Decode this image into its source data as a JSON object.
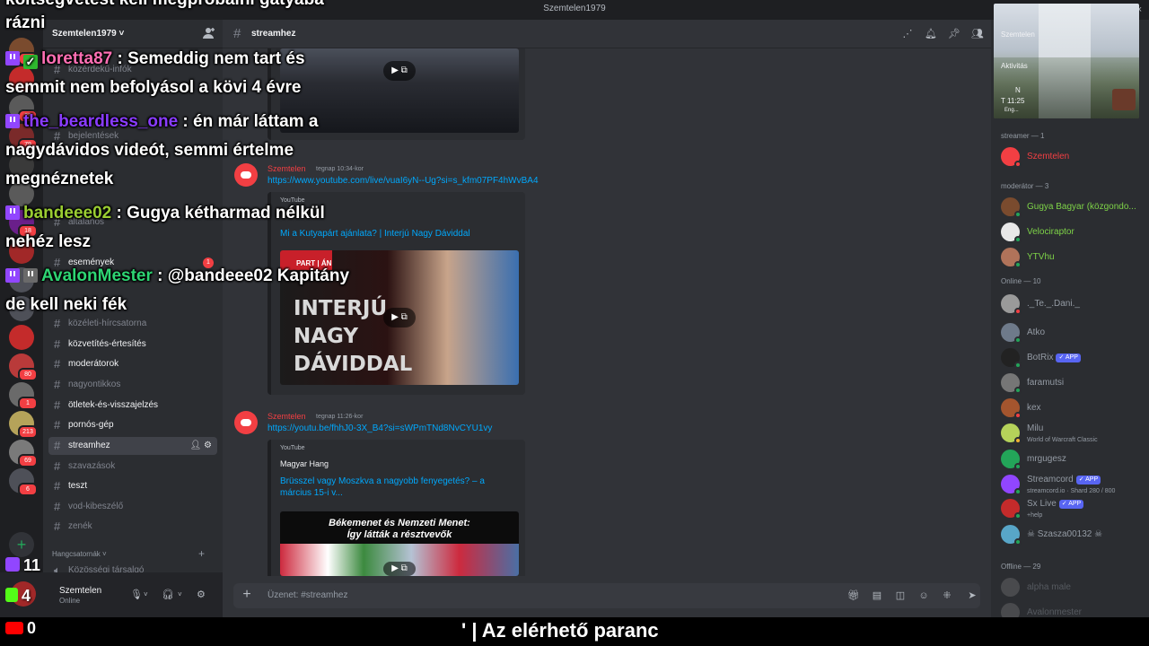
{
  "window": {
    "title": "Szemtelen1979"
  },
  "server": {
    "name": "Szemtelen1979 ˅"
  },
  "server_badges": [
    "16",
    "",
    "23",
    "79",
    "",
    "",
    "18",
    "",
    "",
    "",
    "",
    "80",
    "1",
    "213",
    "69",
    "6"
  ],
  "channels": [
    {
      "name": "közérdekű-infók",
      "style": "dim"
    },
    {
      "name": "bejelentések",
      "style": "dim"
    },
    {
      "name": "szabályok",
      "style": "dim"
    },
    {
      "name": "általános",
      "style": "dim"
    },
    {
      "name": "események",
      "style": "bright",
      "badge": "1"
    },
    {
      "name": "közéleti-hírcsatorna",
      "style": "dim"
    },
    {
      "name": "közvetítés-értesítés",
      "style": "bright"
    },
    {
      "name": "moderátorok",
      "style": "bright"
    },
    {
      "name": "nagyontikkos",
      "style": "dim"
    },
    {
      "name": "ötletek-és-visszajelzés",
      "style": "bright"
    },
    {
      "name": "pornós-gép",
      "style": "bright"
    },
    {
      "name": "streamhez",
      "style": "active"
    },
    {
      "name": "szavazások",
      "style": "dim"
    },
    {
      "name": "teszt",
      "style": "bright"
    },
    {
      "name": "vod-kibeszélő",
      "style": "dim"
    },
    {
      "name": "zenék",
      "style": "dim"
    }
  ],
  "voice_category": "Hangcsatornák",
  "voice_channel": "Közösségi társalgó",
  "user_panel": {
    "name": "Szemtelen",
    "status": "Online"
  },
  "channel_header": {
    "name": "streamhez"
  },
  "messages": [
    {
      "author": "Szemtelen",
      "time": "tegnap 10:34-kor",
      "link": "https://www.youtube.com/live/vuaI6yN--Ug?si=s_kfm07PF4hWvBA4",
      "embed": {
        "provider": "YouTube",
        "author": "",
        "title": "Mi a Kutyapárt ajánlata? | Interjú Nagy Dáviddal",
        "thumb_lines": [
          "INTERJÚ",
          "NAGY",
          "DÁVIDDAL"
        ],
        "thumb_tag": "PART | ÁN"
      }
    },
    {
      "author": "Szemtelen",
      "time": "tegnap 11:26-kor",
      "link": "https://youtu.be/fhhJ0-3X_B4?si=sWPmTNd8NvCYU1vy",
      "embed": {
        "provider": "YouTube",
        "author": "Magyar Hang",
        "title": "Brüsszel vagy Moszkva a nagyobb fenyegetés? – a március 15-i v...",
        "thumb_lines": [
          "Békemenet és Nemzeti Menet:",
          "Így látták a résztvevők"
        ],
        "thumb_tag": ""
      }
    }
  ],
  "composer": {
    "placeholder": "Üzenet: #streamhez"
  },
  "members": {
    "groups": [
      {
        "label": "streamer — 1",
        "items": [
          {
            "name": "Szemtelen",
            "color": "#f23f43",
            "status": "dnd",
            "avatar": "#f23f43"
          }
        ]
      },
      {
        "label": "moderátor — 3",
        "items": [
          {
            "name": "Gugya Bagyar (közgondo...",
            "color": "#7ed348",
            "status": "online",
            "avatar": "#7a4b2e"
          },
          {
            "name": "Velociraptor",
            "color": "#7ed348",
            "status": "online",
            "avatar": "#e8e8e8"
          },
          {
            "name": "YTVhu",
            "color": "#7ed348",
            "status": "online",
            "avatar": "#b0735a"
          }
        ]
      },
      {
        "label": "Online — 10",
        "items": [
          {
            "name": "._Te._.Dani._",
            "color": "#949ba4",
            "status": "dnd",
            "avatar": "#9a9a9a"
          },
          {
            "name": "Atko",
            "color": "#949ba4",
            "status": "online",
            "avatar": "#6e7a8a"
          },
          {
            "name": "BotRix",
            "color": "#949ba4",
            "status": "online",
            "avatar": "#222",
            "app": "✓ APP"
          },
          {
            "name": "faramutsi",
            "color": "#949ba4",
            "status": "online",
            "avatar": "#767676"
          },
          {
            "name": "kex",
            "color": "#949ba4",
            "status": "dnd",
            "avatar": "#a4552e"
          },
          {
            "name": "Milu",
            "color": "#949ba4",
            "status": "idle",
            "avatar": "#b5d25a",
            "sub": "World of Warcraft Classic"
          },
          {
            "name": "mrgugesz",
            "color": "#949ba4",
            "status": "online",
            "avatar": "#23a559"
          },
          {
            "name": "Streamcord",
            "color": "#949ba4",
            "status": "online",
            "avatar": "#9146ff",
            "app": "✓ APP",
            "sub": "streamcord.io · Shard 280 / 800"
          },
          {
            "name": "Sx Live",
            "color": "#949ba4",
            "status": "online",
            "avatar": "#c42b2b",
            "app": "✓ APP",
            "sub": "+help"
          },
          {
            "name": "☠ Szasza00132 ☠",
            "color": "#949ba4",
            "status": "online",
            "avatar": "#58a6c8"
          }
        ]
      },
      {
        "label": "Offline — 29",
        "items": [
          {
            "name": "alpha male",
            "color": "#949ba4",
            "status": "offline",
            "avatar": "#777"
          },
          {
            "name": "Avalonmester",
            "color": "#949ba4",
            "status": "offline",
            "avatar": "#777"
          }
        ]
      }
    ]
  },
  "webcam": {
    "lines": [
      "Szemtelen",
      "Aktivitás",
      "N",
      "T 11:25",
      "Eng..."
    ]
  },
  "chat_overlay": {
    "partial_top": "költségvetést kell megpróbálni gatyába",
    "lines": [
      {
        "text": "rázni"
      },
      {
        "user": "loretta87",
        "user_color": "#ff6fb4",
        "icons": [
          "twitch",
          "check"
        ],
        "msg": "Semeddig nem tart és"
      },
      {
        "text": "semmit nem befolyásol a kövi 4 évre"
      },
      {
        "user": "the_beardless_one",
        "user_color": "#8a3cff",
        "icons": [
          "twitch"
        ],
        "msg": "én már láttam a"
      },
      {
        "text": "nagydávidos videót, semmi értelme"
      },
      {
        "text": "megnéznetek"
      },
      {
        "user": "bandeee02",
        "user_color": "#9acd32",
        "icons": [
          "twitch"
        ],
        "msg": "Gugya kétharmad nélkül"
      },
      {
        "text": "nehéz lesz"
      },
      {
        "user": "AvalonMester",
        "user_color": "#2ed573",
        "icons": [
          "twitch",
          "badge"
        ],
        "msg": "@bandeee02 Kapitány"
      },
      {
        "text": "de kell neki fék"
      }
    ]
  },
  "stream_stats": {
    "twitch_viewers": "11",
    "kick_viewers": "4",
    "youtube_viewers": "0"
  },
  "ticker": {
    "text": "' | Az elérhető paranc"
  },
  "colors": {
    "accent": "#5865f2",
    "brand_red": "#f23f43",
    "online": "#23a559",
    "link": "#00a8fc"
  }
}
